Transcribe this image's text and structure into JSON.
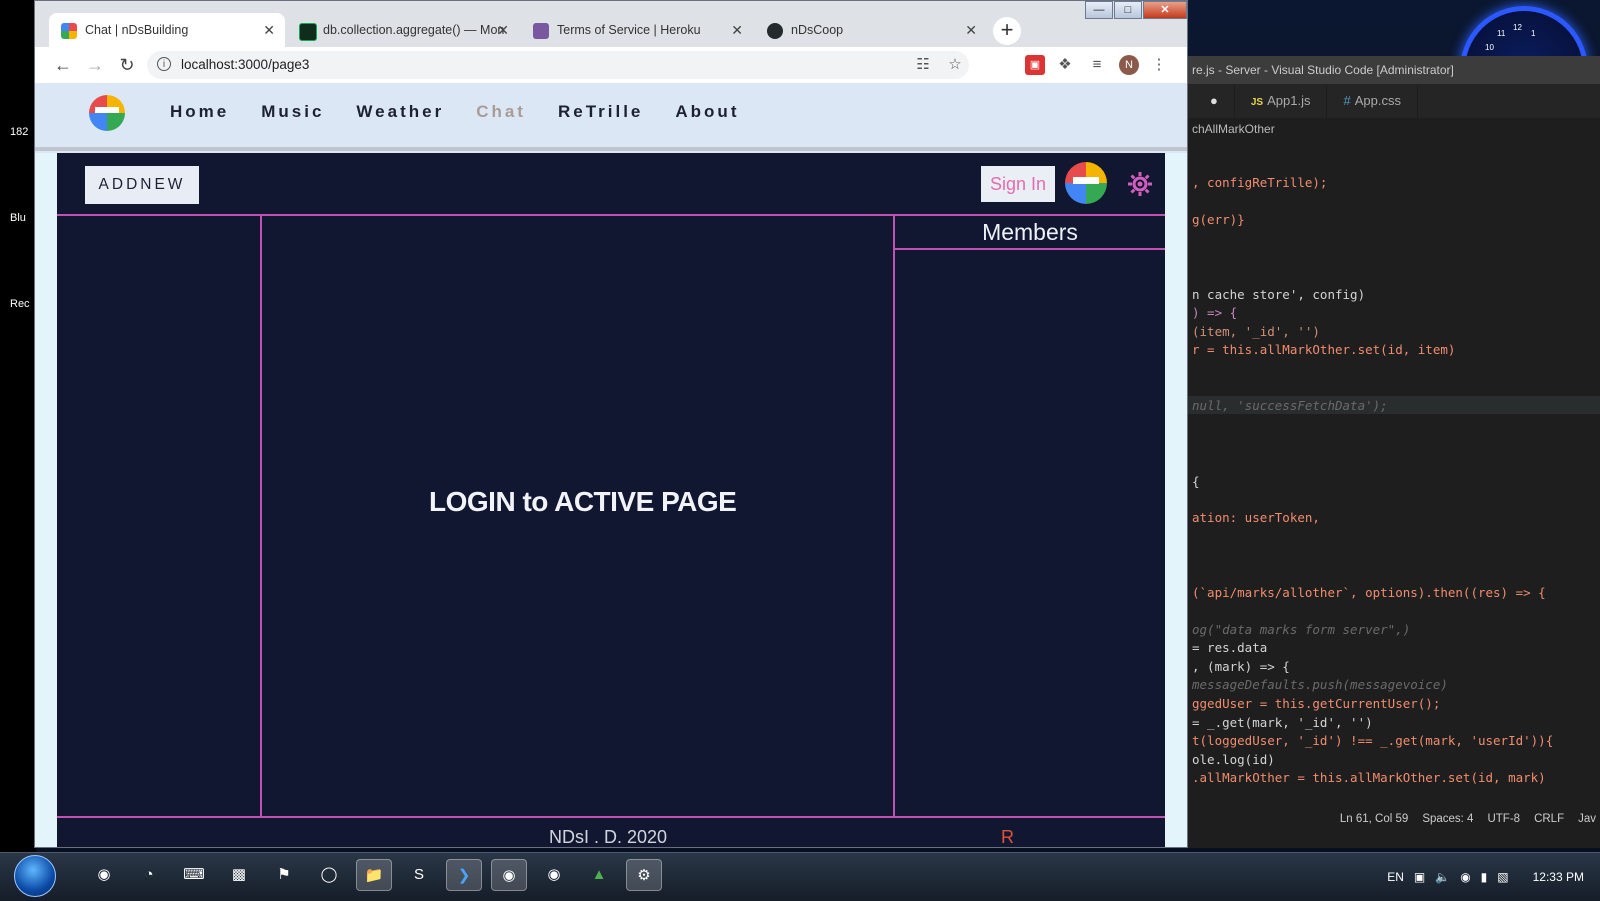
{
  "desktop": {
    "labels": [
      "182",
      "Blu",
      "Rec"
    ],
    "clock_numbers": [
      "11",
      "12",
      "1",
      "10"
    ]
  },
  "vscode": {
    "title": "re.js - Server - Visual Studio Code [Administrator]",
    "tabs": [
      {
        "label": "●",
        "type": "dot"
      },
      {
        "label": "App1.js",
        "badge": "JS"
      },
      {
        "label": "App.css",
        "badge": "#"
      }
    ],
    "breadcrumb": "chAllMarkOther",
    "code_lines": [
      ", configReTrille);",
      "g(err)}",
      "",
      "n cache store', config)",
      ") => {",
      "(item, '_id', '')",
      "r = this.allMarkOther.set(id, item)",
      "null, 'successFetchData');",
      "{",
      "ation: userToken,",
      "(`api/marks/allother`, options).then((res) => {",
      "og(\"data marks form server\",)",
      "= res.data",
      ", (mark) => {",
      "messageDefaults.push(messagevoice)",
      "ggedUser = this.getCurrentUser();",
      "= _.get(mark, '_id', '')",
      "t(loggedUser, '_id') !== _.get(mark, 'userId')){",
      "ole.log(id)",
      ".allMarkOther = this.allMarkOther.set(id, mark)"
    ],
    "status": [
      "Ln 61, Col 59",
      "Spaces: 4",
      "UTF-8",
      "CRLF",
      "Jav"
    ]
  },
  "browser": {
    "tabs": [
      {
        "title": "Chat | nDsBuilding",
        "active": true,
        "icon_color": "#f4b400"
      },
      {
        "title": "db.collection.aggregate() — Mon",
        "active": false,
        "icon_color": "#13aa52"
      },
      {
        "title": "Terms of Service | Heroku",
        "active": false,
        "icon_color": "#79589f"
      },
      {
        "title": "nDsCoop",
        "active": false,
        "icon_color": "#24292e"
      }
    ],
    "url": "localhost:3000/page3",
    "profile_initial": "N"
  },
  "site": {
    "nav": [
      {
        "label": "Home",
        "active": false
      },
      {
        "label": "Music",
        "active": false
      },
      {
        "label": "Weather",
        "active": false
      },
      {
        "label": "Chat",
        "active": true
      },
      {
        "label": "ReTrille",
        "active": false
      },
      {
        "label": "About",
        "active": false
      }
    ],
    "addnew_label": "ADDNEW",
    "signin_label": "Sign In",
    "members_title": "Members",
    "login_message": "LOGIN to ACTIVE PAGE",
    "footer_left": "NDsI . D. 2020",
    "footer_right": "R"
  },
  "taskbar": {
    "language": "EN",
    "time": "12:33 PM"
  },
  "colors": {
    "panel_border": "#c052b6",
    "app_bg": "#111731",
    "signin_text": "#e26db0",
    "nav_active": "#a99c96"
  }
}
